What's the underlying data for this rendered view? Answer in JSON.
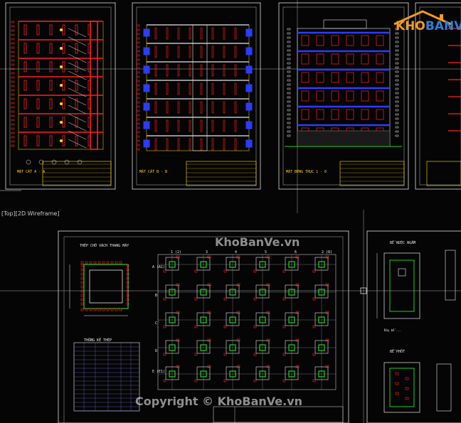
{
  "viewport": {
    "label": "[Top][2D Wireframe]"
  },
  "watermark": {
    "site": "KhoBanVe.vn",
    "copyright": "Copyright © KhoBanVe.vn"
  },
  "logo": {
    "part1": "KHO",
    "part2": "BANVE",
    "accent": "#f39a1f",
    "accent2": "#2f7fd8"
  },
  "sheets": {
    "s1_title": "MẶT CẮT A - A",
    "s2_title": "MẶT CẮT B - B",
    "s3_title": "MẶT ĐỨNG TRỤC 1 - 6"
  },
  "detail": {
    "elevator_title": "THÉP CHỜ VÁCH THANG MÁY",
    "rebar_table": "THỐNG KÊ THÉP",
    "tank_title": "BỂ NƯỚC NGẦM",
    "pit_title": "BỂ PHỐT",
    "tank_note": "Đáy bể ...",
    "cols": [
      "1 (2)",
      "3",
      "4",
      "5",
      "6",
      "2 (8)"
    ],
    "rows": [
      "A (A1)",
      "B",
      "C",
      "D",
      "E (E1)"
    ]
  },
  "colors": {
    "bg": "#050505",
    "red": "#ff2020",
    "yellow": "#ffe600",
    "white": "#e8e8e8",
    "blue": "#2a3cff",
    "green": "#1fd01f",
    "cyan": "#00e0e0",
    "magenta": "#d23cd2"
  }
}
